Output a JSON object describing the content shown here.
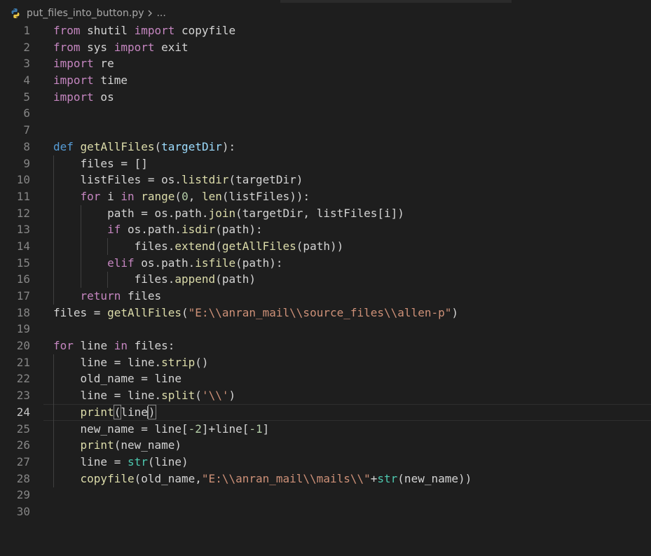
{
  "breadcrumb": {
    "file_name": "put_files_into_button.py",
    "ellipsis": "..."
  },
  "editor": {
    "current_line": 24,
    "lines": [
      {
        "n": "1",
        "tokens": [
          {
            "t": "from",
            "c": "ctl"
          },
          {
            "t": " shutil ",
            "c": "var"
          },
          {
            "t": "import",
            "c": "ctl"
          },
          {
            "t": " copyfile",
            "c": "var"
          }
        ]
      },
      {
        "n": "2",
        "tokens": [
          {
            "t": "from",
            "c": "ctl"
          },
          {
            "t": " sys ",
            "c": "var"
          },
          {
            "t": "import",
            "c": "ctl"
          },
          {
            "t": " exit",
            "c": "var"
          }
        ]
      },
      {
        "n": "3",
        "tokens": [
          {
            "t": "import",
            "c": "ctl"
          },
          {
            "t": " re",
            "c": "var"
          }
        ]
      },
      {
        "n": "4",
        "tokens": [
          {
            "t": "import",
            "c": "ctl"
          },
          {
            "t": " time",
            "c": "var"
          }
        ]
      },
      {
        "n": "5",
        "tokens": [
          {
            "t": "import",
            "c": "ctl"
          },
          {
            "t": " os",
            "c": "var"
          }
        ]
      },
      {
        "n": "6",
        "tokens": []
      },
      {
        "n": "7",
        "tokens": []
      },
      {
        "n": "8",
        "tokens": [
          {
            "t": "def",
            "c": "kw"
          },
          {
            "t": " ",
            "c": "var"
          },
          {
            "t": "getAllFiles",
            "c": "fn"
          },
          {
            "t": "(",
            "c": "var"
          },
          {
            "t": "targetDir",
            "c": "param"
          },
          {
            "t": "):",
            "c": "var"
          }
        ]
      },
      {
        "n": "9",
        "tokens": [
          {
            "t": "    files = []",
            "c": "var"
          }
        ]
      },
      {
        "n": "10",
        "tokens": [
          {
            "t": "    listFiles = os.",
            "c": "var"
          },
          {
            "t": "listdir",
            "c": "fn"
          },
          {
            "t": "(targetDir)",
            "c": "var"
          }
        ]
      },
      {
        "n": "11",
        "tokens": [
          {
            "t": "    ",
            "c": "var"
          },
          {
            "t": "for",
            "c": "ctl"
          },
          {
            "t": " i ",
            "c": "var"
          },
          {
            "t": "in",
            "c": "ctl"
          },
          {
            "t": " ",
            "c": "var"
          },
          {
            "t": "range",
            "c": "fn"
          },
          {
            "t": "(",
            "c": "var"
          },
          {
            "t": "0",
            "c": "num"
          },
          {
            "t": ", ",
            "c": "var"
          },
          {
            "t": "len",
            "c": "fn"
          },
          {
            "t": "(listFiles)):",
            "c": "var"
          }
        ]
      },
      {
        "n": "12",
        "tokens": [
          {
            "t": "        path = os.path.",
            "c": "var"
          },
          {
            "t": "join",
            "c": "fn"
          },
          {
            "t": "(targetDir, listFiles[i])",
            "c": "var"
          }
        ]
      },
      {
        "n": "13",
        "tokens": [
          {
            "t": "        ",
            "c": "var"
          },
          {
            "t": "if",
            "c": "ctl"
          },
          {
            "t": " os.path.",
            "c": "var"
          },
          {
            "t": "isdir",
            "c": "fn"
          },
          {
            "t": "(path):",
            "c": "var"
          }
        ]
      },
      {
        "n": "14",
        "tokens": [
          {
            "t": "            files.",
            "c": "var"
          },
          {
            "t": "extend",
            "c": "fn"
          },
          {
            "t": "(",
            "c": "var"
          },
          {
            "t": "getAllFiles",
            "c": "fn"
          },
          {
            "t": "(path))",
            "c": "var"
          }
        ]
      },
      {
        "n": "15",
        "tokens": [
          {
            "t": "        ",
            "c": "var"
          },
          {
            "t": "elif",
            "c": "ctl"
          },
          {
            "t": " os.path.",
            "c": "var"
          },
          {
            "t": "isfile",
            "c": "fn"
          },
          {
            "t": "(path):",
            "c": "var"
          }
        ]
      },
      {
        "n": "16",
        "tokens": [
          {
            "t": "            files.",
            "c": "var"
          },
          {
            "t": "append",
            "c": "fn"
          },
          {
            "t": "(path)",
            "c": "var"
          }
        ]
      },
      {
        "n": "17",
        "tokens": [
          {
            "t": "    ",
            "c": "var"
          },
          {
            "t": "return",
            "c": "ctl"
          },
          {
            "t": " files",
            "c": "var"
          }
        ]
      },
      {
        "n": "18",
        "tokens": [
          {
            "t": "files = ",
            "c": "var"
          },
          {
            "t": "getAllFiles",
            "c": "fn"
          },
          {
            "t": "(",
            "c": "var"
          },
          {
            "t": "\"E:\\\\anran_mail\\\\source_files\\\\allen-p\"",
            "c": "str"
          },
          {
            "t": ")",
            "c": "var"
          }
        ]
      },
      {
        "n": "19",
        "tokens": []
      },
      {
        "n": "20",
        "tokens": [
          {
            "t": "for",
            "c": "ctl"
          },
          {
            "t": " line ",
            "c": "var"
          },
          {
            "t": "in",
            "c": "ctl"
          },
          {
            "t": " files:",
            "c": "var"
          }
        ]
      },
      {
        "n": "21",
        "tokens": [
          {
            "t": "    line = line.",
            "c": "var"
          },
          {
            "t": "strip",
            "c": "fn"
          },
          {
            "t": "()",
            "c": "var"
          }
        ]
      },
      {
        "n": "22",
        "tokens": [
          {
            "t": "    old_name = line",
            "c": "var"
          }
        ]
      },
      {
        "n": "23",
        "tokens": [
          {
            "t": "    line = line.",
            "c": "var"
          },
          {
            "t": "split",
            "c": "fn"
          },
          {
            "t": "(",
            "c": "var"
          },
          {
            "t": "'\\\\'",
            "c": "str"
          },
          {
            "t": ")",
            "c": "var"
          }
        ]
      },
      {
        "n": "24",
        "tokens": [
          {
            "t": "    ",
            "c": "var"
          },
          {
            "t": "print",
            "c": "fn"
          },
          {
            "t": "(",
            "c": "var",
            "hl": true
          },
          {
            "t": "line",
            "c": "var"
          },
          {
            "t": ")",
            "c": "var",
            "hl": true,
            "cursor_before": true
          }
        ]
      },
      {
        "n": "25",
        "tokens": [
          {
            "t": "    new_name = line[",
            "c": "var"
          },
          {
            "t": "-2",
            "c": "num"
          },
          {
            "t": "]+line[",
            "c": "var"
          },
          {
            "t": "-1",
            "c": "num"
          },
          {
            "t": "]",
            "c": "var"
          }
        ]
      },
      {
        "n": "26",
        "tokens": [
          {
            "t": "    ",
            "c": "var"
          },
          {
            "t": "print",
            "c": "fn"
          },
          {
            "t": "(new_name)",
            "c": "var"
          }
        ]
      },
      {
        "n": "27",
        "tokens": [
          {
            "t": "    line = ",
            "c": "var"
          },
          {
            "t": "str",
            "c": "bi"
          },
          {
            "t": "(line)",
            "c": "var"
          }
        ]
      },
      {
        "n": "28",
        "tokens": [
          {
            "t": "    ",
            "c": "var"
          },
          {
            "t": "copyfile",
            "c": "fn"
          },
          {
            "t": "(old_name,",
            "c": "var"
          },
          {
            "t": "\"E:\\\\anran_mail\\\\mails\\\\\"",
            "c": "str"
          },
          {
            "t": "+",
            "c": "var"
          },
          {
            "t": "str",
            "c": "bi"
          },
          {
            "t": "(new_name))",
            "c": "var"
          }
        ]
      },
      {
        "n": "29",
        "tokens": []
      },
      {
        "n": "30",
        "tokens": []
      }
    ]
  }
}
